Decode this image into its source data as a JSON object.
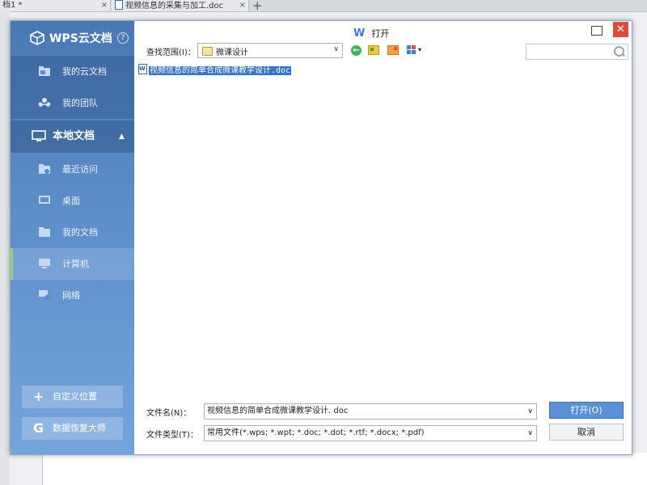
{
  "background_tabs": [
    {
      "label": "档1 *",
      "close": "×"
    },
    {
      "label": "视频信息的采集与加工.doc",
      "close": "×"
    }
  ],
  "new_tab_glyph": "+",
  "dialog": {
    "title": "打开",
    "title_icon": "W",
    "close_glyph": "✕"
  },
  "sidebar": {
    "brand": "WPS云文档",
    "help_glyph": "?",
    "cloud_items": [
      {
        "label": "我的云文档",
        "icon": "cloud-folder-icon"
      },
      {
        "label": "我的团队",
        "icon": "team-icon"
      }
    ],
    "section": {
      "label": "本地文档",
      "icon": "monitor-icon",
      "caret": "▲"
    },
    "local_items": [
      {
        "label": "最近访问",
        "icon": "recent-folder-icon"
      },
      {
        "label": "桌面",
        "icon": "desktop-icon"
      },
      {
        "label": "我的文档",
        "icon": "documents-folder-icon"
      },
      {
        "label": "计算机",
        "icon": "computer-icon",
        "selected": true
      },
      {
        "label": "网络",
        "icon": "network-icon"
      }
    ],
    "custom_location": {
      "label": "自定义位置",
      "glyph": "+"
    },
    "data_recovery": {
      "label": "数据恢复大师",
      "glyph": "G"
    }
  },
  "toolbar": {
    "look_in_label": "查找范围(I)：",
    "look_in_value": "微课设计",
    "back_glyph": "←",
    "view_caret": "▾",
    "search_placeholder": ""
  },
  "files": [
    {
      "name": "视频信息的简单合成微课教学设计.doc",
      "selected": true
    }
  ],
  "bottom": {
    "filename_label": "文件名(N)：",
    "filename_value": "视频信息的简单合成微课教学设计. doc",
    "filetype_label": "文件类型(T)：",
    "filetype_value": "常用文件(*.wps; *.wpt; *.doc; *.dot; *.rtf; *.docx; *.pdf)",
    "dropdown_glyph": "∨",
    "open_label": "打开(O)",
    "cancel_label": "取消"
  },
  "colors": {
    "sidebar_top": "#4a78b4",
    "sidebar_bottom": "#74a4dc",
    "selection": "#3572c6",
    "close_red": "#e04b3c",
    "open_button": "#5b8fd6",
    "selected_nav_marker": "#8ed86c"
  }
}
